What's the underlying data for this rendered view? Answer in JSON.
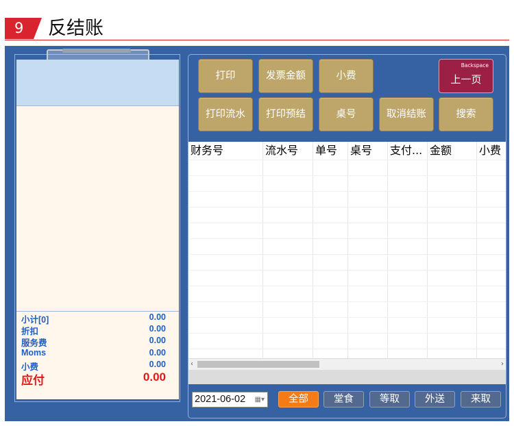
{
  "header": {
    "number": "9",
    "title": "反结账"
  },
  "receipt": {
    "subtotal_label": "小计[0]",
    "subtotal_value": "0.00",
    "discount_label": "折扣",
    "discount_value": "0.00",
    "service_label": "服务费",
    "service_value": "0.00",
    "moms_label": "Moms",
    "moms_value": "0.00",
    "tip_label": "小费",
    "tip_value": "0.00",
    "due_label": "应付",
    "due_value": "0.00"
  },
  "buttons": {
    "print": "打印",
    "invoice_amount": "发票金额",
    "tip": "小费",
    "prev_hint": "Backspace",
    "prev_page": "上一页",
    "print_flow": "打印流水",
    "print_pre": "打印预结",
    "table_no": "桌号",
    "cancel_checkout": "取消结账",
    "search": "搜索"
  },
  "table": {
    "columns": [
      "财务号",
      "流水号",
      "单号",
      "桌号",
      "支付...",
      "金额",
      "小费"
    ]
  },
  "filter": {
    "date": "2021-06-02",
    "all": "全部",
    "dine_in": "堂食",
    "wait": "等取",
    "delivery": "外送",
    "pickup": "来取"
  },
  "colors": {
    "accent": "#d9232f",
    "frame": "#3662a3",
    "gold": "#bea66b",
    "active": "#f47b16"
  }
}
